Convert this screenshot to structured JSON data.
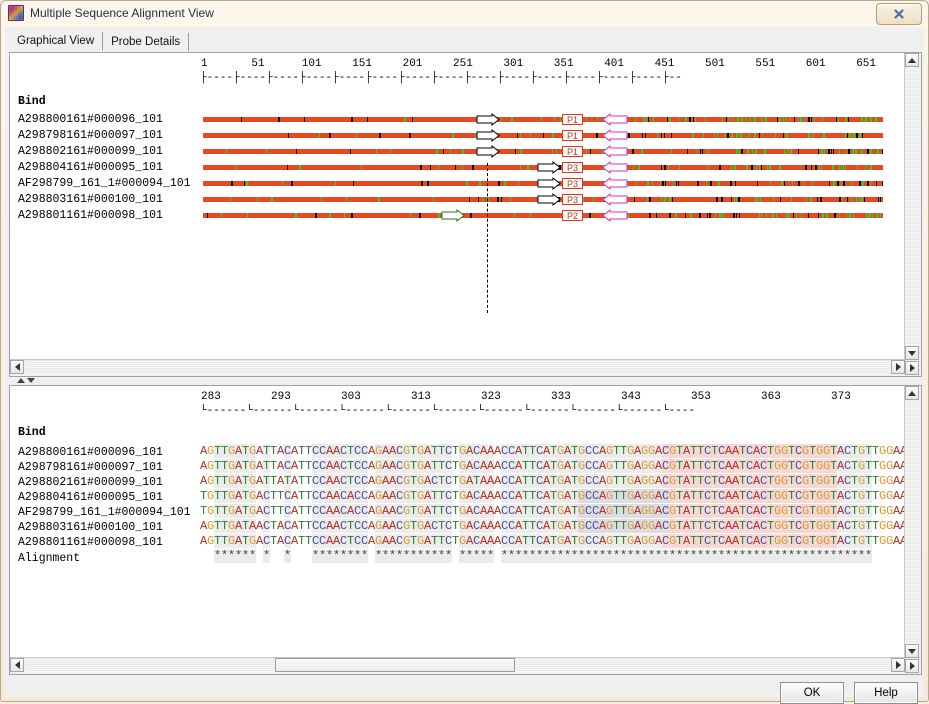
{
  "window": {
    "title": "Multiple Sequence Alignment View",
    "icon": "app-icon",
    "close_label": "✕"
  },
  "tabs": [
    {
      "label": "Graphical View",
      "active": true
    },
    {
      "label": "Probe Details",
      "active": false
    }
  ],
  "graphical_view": {
    "bind_label": "Bind",
    "ruler_numbers": [
      "1",
      "51",
      "101",
      "151",
      "201",
      "251",
      "301",
      "351",
      "401",
      "451",
      "501",
      "551",
      "601",
      "651"
    ],
    "ruler_tick_pattern": "├----",
    "sequence_names": [
      "A298800161#000096_101",
      "A298798161#000097_101",
      "A298802161#000099_101",
      "A298804161#000095_101",
      "AF298799_161_1#000094_101",
      "A298803161#000100_101",
      "A298801161#000098_101"
    ],
    "probe_labels": [
      "P1",
      "P1",
      "P1",
      "P3",
      "P3",
      "P3",
      "P2"
    ],
    "forward_arrow_color": "#000000",
    "reverse_arrow_color": "#cc33cc",
    "probe_box_color": "#e03b20",
    "bar_base_color": "#e8491e",
    "bar_mark_green": "#33cc33",
    "bar_mark_black": "#000000",
    "cursor_line": "dashed"
  },
  "alignment_view": {
    "bind_label": "Bind",
    "alignment_label": "Alignment",
    "ruler_numbers": [
      "283",
      "293",
      "303",
      "313",
      "323",
      "333",
      "343",
      "353",
      "363",
      "373"
    ],
    "ruler_tick_pattern": "└------",
    "sequence_names": [
      "A298800161#000096_101",
      "A298798161#000097_101",
      "A298802161#000099_101",
      "A298804161#000095_101",
      "AF298799_161_1#000094_101",
      "A298803161#000100_101",
      "A298801161#000098_101"
    ],
    "sequences": [
      "AGTTGATGATTACATTCCAACTCCAGAACGTGATTCTGACAAACCATTCATGATGCCAGTTGAGGACGTATTCTCAATCACTGGTCGTGGTACTGTTGGAA",
      "AGTTGATGATTACATTCCAACTCCAGAACGTGATTCTGACAAACCATTCATGATGCCAGTTGAGGACGTATTCTCAATCACTGGTCGTGGTACTGTTGGAA",
      "AGTTGATGATTATATTCCAACTCCAGAACGTGACTCTGATAAACCATTCATGATGCCAGTTGAGGACGTATTCTCAATCACTGGTCGTGGTACTGTTGGAA",
      "TGTTGATGACTTCATTCCAACACCAGAACGTGATTCTGACAAACCATTCATGATGCCAGTTGAGGACGTATTCTCAATCACTGGTCGTGGTACTGTTGGAA",
      "TGTTGATGACTTCATTCCAACACCAGAACGTGATTCTGACAAACCATTCATGATGCCAGTTGAGGACGTATTCTCAATCACTGGTCGTGGTACTGTTGGAA",
      "AGTTGATAACTACATTCCAACTCCAGAACGTGACTCTGACAAACCATTCATGATGCCAGTTGAGGACGTATTCTCAATCACTGGTCGTGGTACTGTTGGAA",
      "AGTTGATGACTACATTCCAACTCCAGAACGTGATTCTGACAAACCATTCATGATGCCAGTTGAGGACGTATTCTCAATCACTGGTCGTGGTACTGTTGGAA"
    ],
    "consensus": "  ****** *  *   ******** *********** ***** *****************************************************",
    "base_colors": {
      "A": "#b02b22",
      "C": "#4a4f9c",
      "G": "#d59b34",
      "T": "#2e7d32"
    }
  },
  "buttons": {
    "ok": "OK",
    "help": "Help"
  },
  "scrollbars": {
    "up_arrow": "▲",
    "down_arrow": "▼",
    "left_arrow": "◄",
    "right_arrow": "►"
  }
}
